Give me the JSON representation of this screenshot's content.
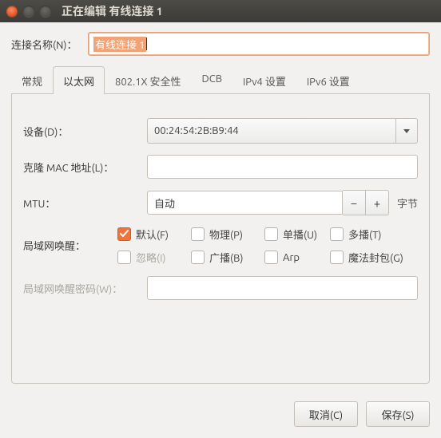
{
  "titlebar": {
    "title": "正在编辑 有线连接 1"
  },
  "connection": {
    "label": "连接名称(N)：",
    "value": "有线连接 1"
  },
  "tabs": [
    "常规",
    "以太网",
    "802.1X 安全性",
    "DCB",
    "IPv4 设置",
    "IPv6 设置"
  ],
  "form": {
    "device": {
      "label": "设备(D)：",
      "value": "00:24:54:2B:B9:44"
    },
    "clone": {
      "label": "克隆 MAC 地址(L)：",
      "value": ""
    },
    "mtu": {
      "label": "MTU：",
      "value": "自动",
      "unit": "字节"
    },
    "wol": {
      "label": "局域网唤醒："
    },
    "wol_checks": [
      {
        "label": "默认(F)",
        "checked": true,
        "disabled": false
      },
      {
        "label": "物理(P)",
        "checked": false,
        "disabled": false
      },
      {
        "label": "单播(U)",
        "checked": false,
        "disabled": false
      },
      {
        "label": "多播(T)",
        "checked": false,
        "disabled": false
      },
      {
        "label": "忽略(I)",
        "checked": false,
        "disabled": true
      },
      {
        "label": "广播(B)",
        "checked": false,
        "disabled": false
      },
      {
        "label": "Arp",
        "checked": false,
        "disabled": false
      },
      {
        "label": "魔法封包(G)",
        "checked": false,
        "disabled": false
      }
    ],
    "wol_pw": {
      "label": "局域网唤醒密码(W)：",
      "value": ""
    }
  },
  "buttons": {
    "cancel": "取消(C)",
    "save": "保存(S)"
  }
}
